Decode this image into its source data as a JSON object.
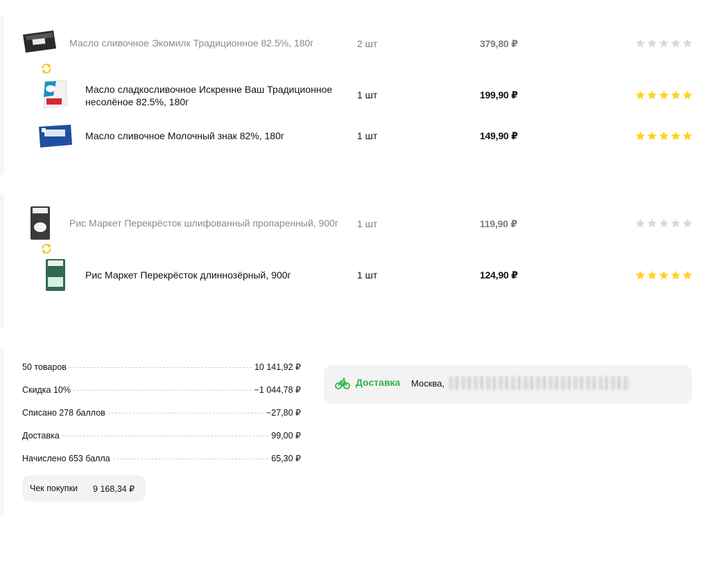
{
  "groups": [
    {
      "original": {
        "name": "Масло сливочное Экомилк Традиционное 82.5%, 180г",
        "qty": "2 шт",
        "price": "379,80 ₽",
        "rating": 0
      },
      "replacements": [
        {
          "name": "Масло сладкосливочное Искренне Ваш Традиционное несолёное 82.5%, 180г",
          "qty": "1 шт",
          "price": "199,90 ₽",
          "rating": 5
        },
        {
          "name": "Масло сливочное Молочный знак 82%, 180г",
          "qty": "1 шт",
          "price": "149,90 ₽",
          "rating": 5
        }
      ]
    },
    {
      "original": {
        "name": "Рис Маркет Перекрёсток шлифованный пропаренный, 900г",
        "qty": "1 шт",
        "price": "119,90 ₽",
        "rating": 0
      },
      "replacements": [
        {
          "name": "Рис Маркет Перекрёсток длиннозёрный, 900г",
          "qty": "1 шт",
          "price": "124,90 ₽",
          "rating": 5
        }
      ]
    }
  ],
  "summary": {
    "rows": [
      {
        "label": "50 товаров",
        "value": "10 141,92 ₽"
      },
      {
        "label": "Скидка 10%",
        "value": "−1 044,78 ₽"
      },
      {
        "label": "Списано 278 баллов",
        "value": "−27,80 ₽"
      },
      {
        "label": "Доставка",
        "value": "99,00 ₽"
      },
      {
        "label": "Начислено 653 балла",
        "value": "65,30 ₽"
      }
    ],
    "check_label": "Чек покупки",
    "check_value": "9 168,34 ₽"
  },
  "delivery": {
    "label": "Доставка",
    "city": "Москва,"
  },
  "colors": {
    "star_active": "#FFD21F",
    "star_inactive": "#D9D9D9",
    "swap": "#F5C518",
    "delivery_green": "#2DB34A"
  }
}
